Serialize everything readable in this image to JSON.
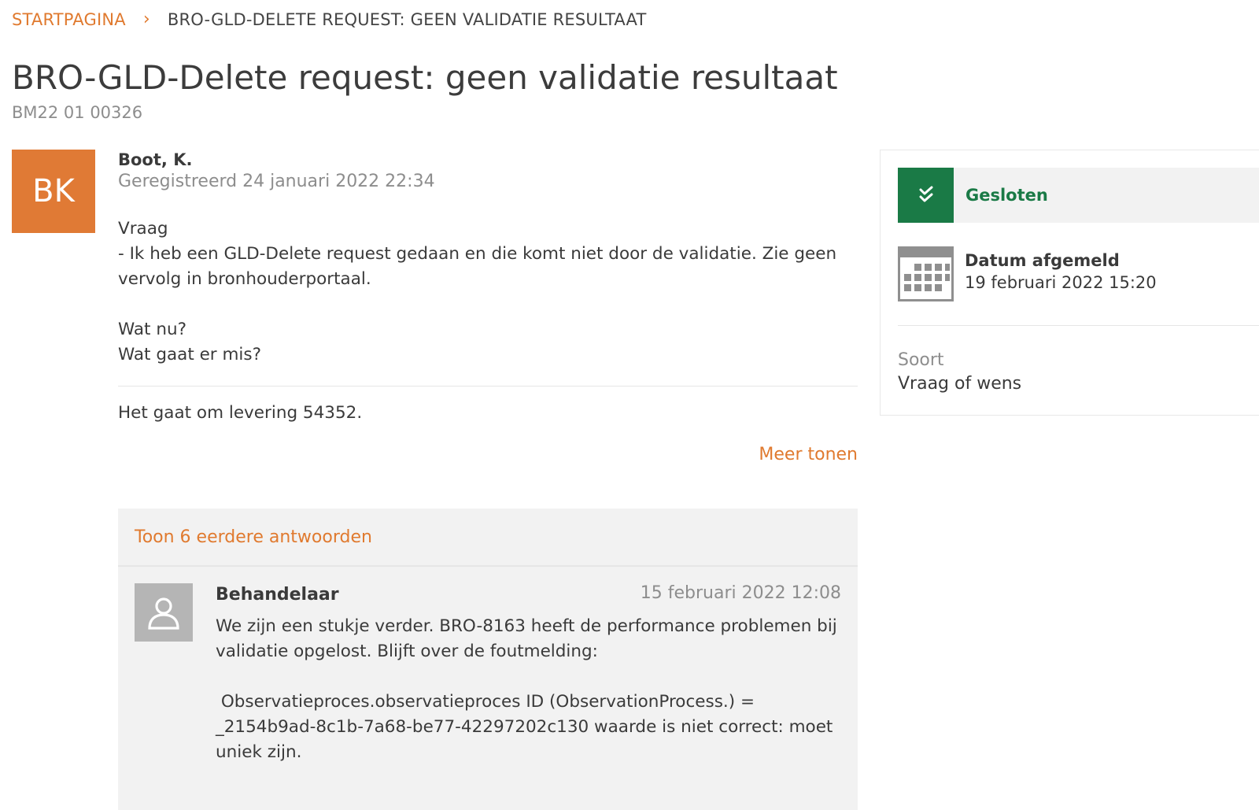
{
  "breadcrumb": {
    "home": "STARTPAGINA",
    "separator": "›",
    "current": "BRO-GLD-DELETE REQUEST: GEEN VALIDATIE RESULTAAT"
  },
  "ticket": {
    "title": "BRO-GLD-Delete request: geen validatie resultaat",
    "id": "BM22 01 00326"
  },
  "question": {
    "avatar_initials": "BK",
    "author": "Boot, K.",
    "registered": "Geregistreerd 24 januari 2022 22:34",
    "lines": [
      "Vraag",
      "- Ik heb een GLD-Delete request gedaan en die komt niet door de validatie. Zie geen vervolg in bronhouderportaal.",
      "",
      "Wat nu?",
      "Wat gaat er mis?"
    ],
    "delivery": "Het gaat om levering 54352.",
    "more_link": "Meer tonen"
  },
  "answers": {
    "show_earlier": "Toon 6 eerdere antwoorden",
    "latest": {
      "author": "Behandelaar",
      "date": "15 februari 2022 12:08",
      "lines": [
        "We zijn een stukje verder.  BRO-8163 heeft de performance problemen bij validatie opgelost. Blijft over de foutmelding:",
        "",
        " Observatieproces.observatieproces ID (ObservationProcess.) = _2154b9ad-8c1b-7a68-be77-42297202c130 waarde is niet correct: moet uniek zijn."
      ]
    }
  },
  "sidebar": {
    "status": "Gesloten",
    "date_label": "Datum afgemeld",
    "date_value": "19 februari 2022 15:20",
    "type_label": "Soort",
    "type_value": "Vraag of wens"
  },
  "colors": {
    "accent_orange": "#e07a2f",
    "status_green": "#1a7a46"
  }
}
